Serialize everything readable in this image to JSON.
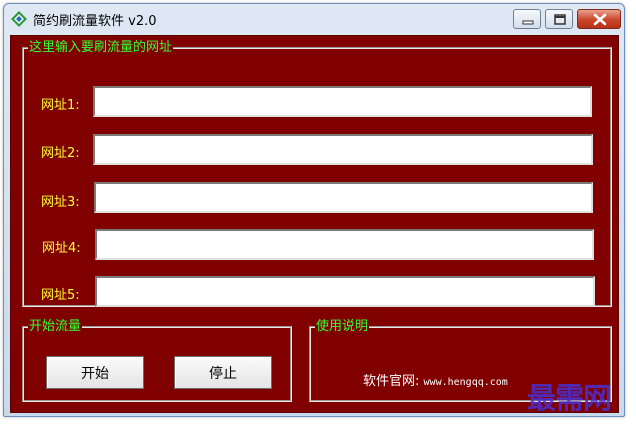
{
  "window": {
    "title": "简约刷流量软件 v2.0",
    "icon": "diamond-arrows-icon",
    "controls": [
      "minimize-icon",
      "maximize-icon",
      "close-icon"
    ]
  },
  "colors": {
    "client_background": "#800000",
    "legend_text": "#33ff33",
    "label_text": "#ffff33",
    "watermark": "#4a2fd0"
  },
  "url_group": {
    "legend": "这里输入要刷流量的网址",
    "fields": [
      {
        "label": "网址1:",
        "value": "",
        "placeholder": ""
      },
      {
        "label": "网址2:",
        "value": "",
        "placeholder": ""
      },
      {
        "label": "网址3:",
        "value": "",
        "placeholder": ""
      },
      {
        "label": "网址4:",
        "value": "",
        "placeholder": ""
      },
      {
        "label": "网址5:",
        "value": "",
        "placeholder": ""
      }
    ]
  },
  "start_group": {
    "legend": "开始流量",
    "start_label": "开始",
    "stop_label": "停止"
  },
  "help_group": {
    "legend": "使用说明",
    "site_label": "软件官网:",
    "site_url": "www.hengqq.com"
  },
  "watermark": "最需网"
}
